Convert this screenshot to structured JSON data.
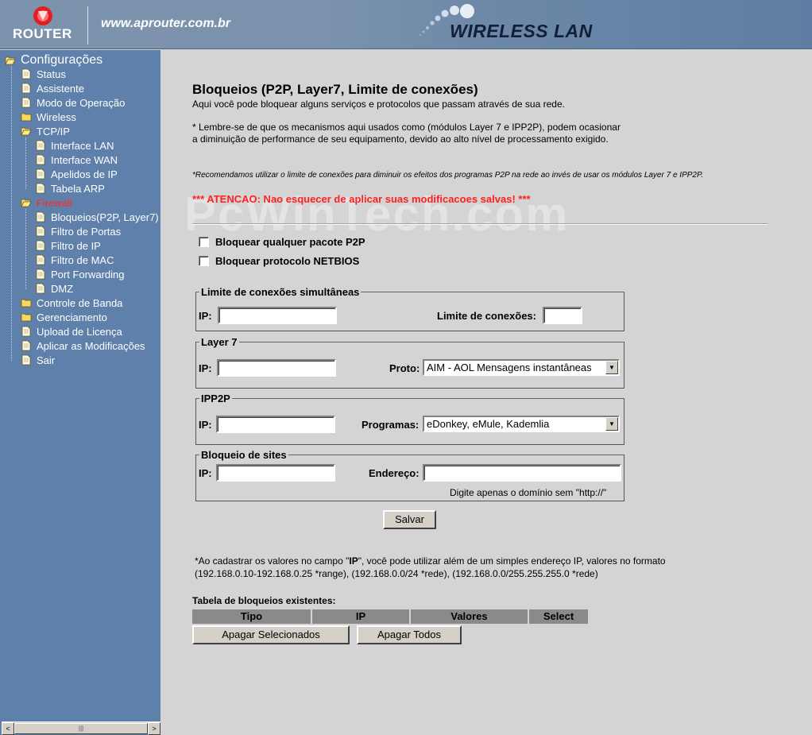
{
  "header": {
    "logo_text": "ROUTER",
    "site_url": "www.aprouter.com.br",
    "banner_title": "WIRELESS LAN"
  },
  "sidebar": {
    "root": "Configurações",
    "items": [
      {
        "label": "Status",
        "type": "page"
      },
      {
        "label": "Assistente",
        "type": "page"
      },
      {
        "label": "Modo de Operação",
        "type": "page"
      },
      {
        "label": "Wireless",
        "type": "folder"
      },
      {
        "label": "TCP/IP",
        "type": "folder-open"
      },
      {
        "label": "Interface LAN",
        "type": "page"
      },
      {
        "label": "Interface WAN",
        "type": "page"
      },
      {
        "label": "Apelidos de IP",
        "type": "page"
      },
      {
        "label": "Tabela ARP",
        "type": "page"
      },
      {
        "label": "Firewall",
        "type": "folder-open"
      },
      {
        "label": "Bloqueios(P2P, Layer7)",
        "type": "page"
      },
      {
        "label": "Filtro de Portas",
        "type": "page"
      },
      {
        "label": "Filtro de IP",
        "type": "page"
      },
      {
        "label": "Filtro de MAC",
        "type": "page"
      },
      {
        "label": "Port Forwarding",
        "type": "page"
      },
      {
        "label": "DMZ",
        "type": "page"
      },
      {
        "label": "Controle de Banda",
        "type": "folder"
      },
      {
        "label": "Gerenciamento",
        "type": "folder"
      },
      {
        "label": "Upload de Licença",
        "type": "page"
      },
      {
        "label": "Aplicar as Modificações",
        "type": "page"
      },
      {
        "label": "Sair",
        "type": "page"
      }
    ],
    "scroll_arrow_left": "<",
    "scroll_arrow_right": ">",
    "scroll_grip": "|||"
  },
  "main": {
    "title": "Bloqueios (P2P, Layer7, Limite de conexões)",
    "intro": "Aqui você pode bloquear alguns serviços e protocolos que passam através de sua rede.",
    "note1": "* Lembre-se de que os mecanismos aqui usados como (módulos Layer 7 e IPP2P), podem ocasionar a diminuição de performance de seu equipamento, devido ao alto nível de processamento exigido.",
    "note2": "*Recomendamos utilizar o limite de conexões para diminuir os efeitos dos programas P2P na rede ao invés de usar os módulos Layer 7 e IPP2P.",
    "warning": "*** ATENCAO: Nao esquecer de aplicar suas modificacoes salvas! ***",
    "watermark": "PcWinTech.com",
    "checkboxes": {
      "p2p": "Bloquear qualquer pacote P2P",
      "netbios": "Bloquear protocolo NETBIOS"
    },
    "limit": {
      "legend": "Limite de conexões simultâneas",
      "ip_label": "IP:",
      "ip_value": "",
      "limit_label": "Limite de conexões:",
      "limit_value": ""
    },
    "layer7": {
      "legend": "Layer 7",
      "ip_label": "IP:",
      "ip_value": "",
      "proto_label": "Proto:",
      "proto_selected": "AIM - AOL Mensagens instantâneas"
    },
    "ipp2p": {
      "legend": "IPP2P",
      "ip_label": "IP:",
      "ip_value": "",
      "prog_label": "Programas:",
      "prog_selected": "eDonkey, eMule, Kademlia"
    },
    "sites": {
      "legend": "Bloqueio de sites",
      "ip_label": "IP:",
      "ip_value": "",
      "addr_label": "Endereço:",
      "addr_value": "",
      "hint": "Digite apenas o domínio sem \"http://\""
    },
    "save_label": "Salvar",
    "footnote_prefix": "*Ao cadastrar os valores no campo \"",
    "footnote_ip": "IP",
    "footnote_rest": "\", você pode utilizar além de um simples endereço IP, valores no formato (192.168.0.10-192.168.0.25 *range), (192.168.0.0/24 *rede), (192.168.0.0/255.255.255.0 *rede)",
    "table": {
      "title": "Tabela de bloqueios existentes:",
      "headers": [
        "Tipo",
        "IP",
        "Valores",
        "Select"
      ]
    },
    "delete_selected_label": "Apagar Selecionados",
    "delete_all_label": "Apagar Todos"
  }
}
